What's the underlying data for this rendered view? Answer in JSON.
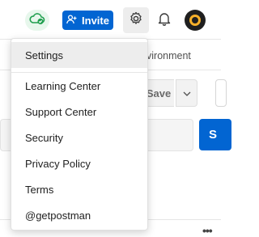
{
  "header": {
    "invite_label": "Invite",
    "sync_icon": "cloud-check-icon",
    "settings_icon": "gear-icon",
    "notifications_icon": "bell-icon",
    "colors": {
      "brand_blue": "#0265d2",
      "sync_green": "#1e9e4d"
    }
  },
  "workspace": {
    "environment_tab_fragment": "vironment",
    "save_label": "Save",
    "send_label_fragment": "S",
    "more_label": "•••"
  },
  "settings_menu": {
    "items": [
      {
        "label": "Settings",
        "active": true
      },
      {
        "label": "Learning Center"
      },
      {
        "label": "Support Center"
      },
      {
        "label": "Security"
      },
      {
        "label": "Privacy Policy"
      },
      {
        "label": "Terms"
      },
      {
        "label": "@getpostman"
      }
    ]
  }
}
